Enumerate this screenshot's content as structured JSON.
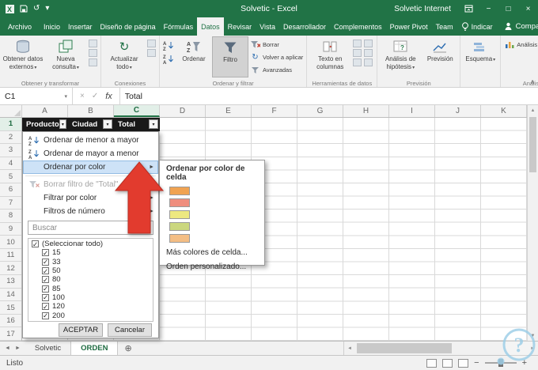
{
  "window": {
    "title": "Solvetic - Excel",
    "account": "Solvetic Internet"
  },
  "tabs": {
    "file": "Archivo",
    "items": [
      "Inicio",
      "Insertar",
      "Diseño de página",
      "Fórmulas",
      "Datos",
      "Revisar",
      "Vista",
      "Desarrollador",
      "Complementos",
      "Power Pivot",
      "Team"
    ],
    "active": "Datos",
    "tell_me": "Indicar",
    "share": "Compartir"
  },
  "ribbon": {
    "get_external": "Obtener datos externos",
    "new_query": "Nueva consulta",
    "group_get": "Obtener y transformar",
    "refresh_all": "Actualizar todo",
    "group_conn": "Conexiones",
    "sort": "Ordenar",
    "filter": "Filtro",
    "clear": "Borrar",
    "reapply": "Volver a aplicar",
    "advanced": "Avanzadas",
    "group_sortfilter": "Ordenar y filtrar",
    "text_cols": "Texto en columnas",
    "group_tools": "Herramientas de datos",
    "whatif": "Análisis de hipótesis",
    "forecast_btn": "Previsión",
    "group_forecast": "Previsión",
    "outline": "Esquema",
    "analysis_btn": "Análisis de datos",
    "group_analysis": "Análisis"
  },
  "formula_bar": {
    "name_box": "C1",
    "fx": "fx",
    "value": "Total"
  },
  "grid": {
    "columns": [
      "A",
      "B",
      "C",
      "D",
      "E",
      "F",
      "G",
      "H",
      "I",
      "J",
      "K"
    ],
    "selected_column": "C",
    "rows": 17,
    "selected_row": 1,
    "headers": [
      {
        "col": 0,
        "cell": "A1",
        "label": "Producto"
      },
      {
        "col": 1,
        "cell": "B1",
        "label": "Ciudad"
      },
      {
        "col": 2,
        "cell": "C1",
        "label": "Total"
      }
    ]
  },
  "filter_menu": {
    "sort_asc": "Ordenar de menor a mayor",
    "sort_desc": "Ordenar de mayor a menor",
    "sort_by_color": "Ordenar por color",
    "clear_filter": "Borrar filtro de \"Total\"",
    "filter_by_color": "Filtrar por color",
    "number_filters": "Filtros de número",
    "search_placeholder": "Buscar",
    "items": [
      "(Seleccionar todo)",
      "15",
      "33",
      "50",
      "80",
      "85",
      "100",
      "120",
      "200"
    ],
    "ok": "ACEPTAR",
    "cancel": "Cancelar"
  },
  "submenu": {
    "title": "Ordenar por color de celda",
    "colors": [
      "#f0a352",
      "#ef8e7e",
      "#ede880",
      "#cbd77e",
      "#f4be84"
    ],
    "more_colors": "Más colores de celda...",
    "custom_sort": "Orden personalizado..."
  },
  "sheet_bar": {
    "tabs": [
      {
        "label": "Solvetic",
        "active": false
      },
      {
        "label": "ORDEN",
        "active": true
      }
    ]
  },
  "status": {
    "mode": "Listo"
  },
  "icons": {
    "dropdown": "▾",
    "check": "✓",
    "minimize": "−",
    "maximize": "□",
    "close": "×",
    "undo": "↺",
    "refresh": "↻",
    "add_sheet": "⊕",
    "up": "▲",
    "down": "▼",
    "left": "◄",
    "right": "►",
    "collapse": "∧",
    "submenu_arrow": "►"
  },
  "colors": {
    "accent_green": "#217346",
    "header_row": "#191919",
    "arrow_red": "#e23b2e"
  }
}
